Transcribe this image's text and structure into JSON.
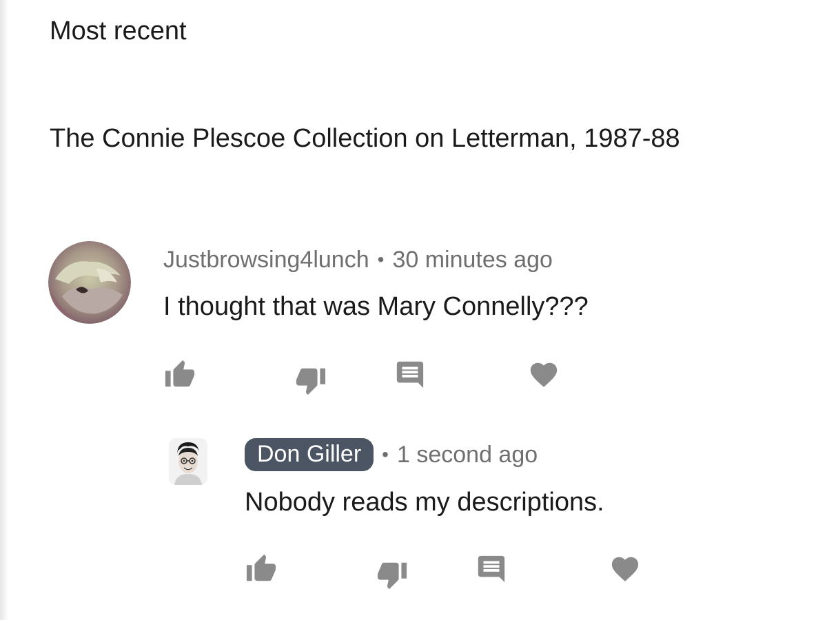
{
  "sort_label": "Most recent",
  "video_title": "The Connie Plescoe Collection on Letterman, 1987-88",
  "comments": [
    {
      "author": "Justbrowsing4lunch",
      "separator": "•",
      "time": "30 minutes ago",
      "text": "I thought that was Mary Connelly???",
      "avatar_icon": "avatar-photo-icon",
      "actions": [
        "thumbs-up-icon",
        "thumbs-down-icon",
        "reply-icon",
        "heart-icon"
      ]
    },
    {
      "author": "Don Giller",
      "separator": "•",
      "time": "1 second ago",
      "text": "Nobody reads my descriptions.",
      "avatar_icon": "avatar-photo-icon",
      "highlight_color": "#4b5563",
      "actions": [
        "thumbs-up-icon",
        "thumbs-down-icon",
        "reply-icon",
        "heart-icon"
      ]
    }
  ],
  "colors": {
    "icon": "#8a8a8a",
    "meta_text": "#6f6f6f",
    "body_text": "#1a1a1a"
  }
}
